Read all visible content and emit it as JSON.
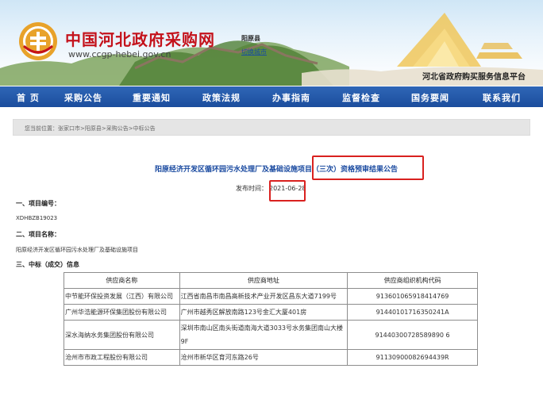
{
  "header": {
    "site_title": "中国河北政府采购网",
    "site_url": "www.ccgp-hebei.gov.cn",
    "region_name": "阳原县",
    "region_sub": "切换城市",
    "platform_name": "河北省政府购买服务信息平台"
  },
  "nav": {
    "items": [
      "首 页",
      "采购公告",
      "重要通知",
      "政策法规",
      "办事指南",
      "监督检查",
      "国务要闻",
      "联系我们"
    ]
  },
  "breadcrumb": {
    "prefix": "您当前位置：",
    "path": "张家口市>阳原县>采购公告>中标公告"
  },
  "notice": {
    "title": "阳原经济开发区循环园污水处理厂及基础设施项目（三次）资格预审结果公告",
    "publish_label": "发布时间：",
    "publish_date": "2021-06-28"
  },
  "sections": {
    "project_no_label": "一、项目编号：",
    "project_no": "XDHBZB19023",
    "project_name_label": "二、项目名称：",
    "project_name": "阳原经济开发区循环园污水处理厂及基础设施项目",
    "winner_label": "三、中标（成交）信息"
  },
  "table": {
    "headers": [
      "供应商名称",
      "供应商地址",
      "供应商组织机构代码"
    ],
    "rows": [
      [
        "中节能环保投资发展（江西）有限公司",
        "江西省南昌市南昌高新技术产业开发区昌东大道7199号",
        "913601065918414769"
      ],
      [
        "广州华浩能源环保集团股份有限公司",
        "广州市越秀区解放南路123号金汇大厦401房",
        "91440101716350241A"
      ],
      [
        "深水海纳水务集团股份有限公司",
        "深圳市南山区南头街道南海大道3033号水务集团南山大楼9F",
        "91440300728589890 6"
      ],
      [
        "沧州市市政工程股份有限公司",
        "沧州市新华区育河东路26号",
        "91130900082694439R"
      ]
    ]
  },
  "colors": {
    "nav_bg": "#1b4d9d",
    "title_red": "#c4121b",
    "title_blue": "#1a4aa0",
    "highlight_box": "#d9211f"
  }
}
